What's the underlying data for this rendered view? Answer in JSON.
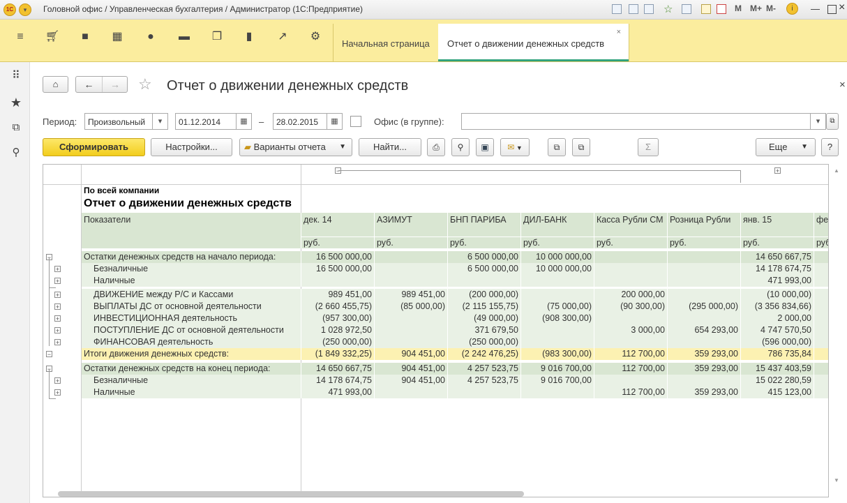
{
  "window": {
    "title": "Головной офис / Управленческая бухгалтерия / Администратор  (1С:Предприятие)",
    "toolbar_m": "M",
    "toolbar_mplus": "M+",
    "toolbar_mminus": "M-"
  },
  "tabs": [
    {
      "label": "Начальная страница"
    },
    {
      "label": "Отчет о движении денежных средств"
    }
  ],
  "page": {
    "title": "Отчет о движении денежных средств",
    "close": "×"
  },
  "filters": {
    "period_label": "Период:",
    "period_type": "Произвольный",
    "date_from": "01.12.2014",
    "date_sep": "–",
    "date_to": "28.02.2015",
    "office_label": "Офис (в группе):",
    "office_value": ""
  },
  "buttons": {
    "generate": "Сформировать",
    "settings": "Настройки...",
    "variants": "Варианты отчета",
    "find": "Найти...",
    "more": "Еще",
    "help": "?",
    "sigma": "Σ"
  },
  "report": {
    "company": "По всей компании",
    "title": "Отчет о движении денежных средств",
    "indicators_header": "Показатели",
    "columns": [
      {
        "name": "дек. 14",
        "unit": "руб."
      },
      {
        "name": "АЗИМУТ",
        "unit": "руб."
      },
      {
        "name": "БНП ПАРИБА",
        "unit": "руб."
      },
      {
        "name": "ДИЛ-БАНК",
        "unit": "руб."
      },
      {
        "name": "Касса Рубли СМ",
        "unit": "руб."
      },
      {
        "name": "Розница Рубли",
        "unit": "руб."
      },
      {
        "name": "янв. 15",
        "unit": "руб."
      },
      {
        "name": "фе",
        "unit": "руб"
      }
    ],
    "rows": [
      {
        "label": "Остатки денежных средств на начало периода:",
        "values": [
          "16 500 000,00",
          "",
          "6 500 000,00",
          "10 000 000,00",
          "",
          "",
          "14 650 667,75",
          ""
        ]
      },
      {
        "label": "Безналичные",
        "values": [
          "16 500 000,00",
          "",
          "6 500 000,00",
          "10 000 000,00",
          "",
          "",
          "14 178 674,75",
          ""
        ]
      },
      {
        "label": "Наличные",
        "values": [
          "",
          "",
          "",
          "",
          "",
          "",
          "471 993,00",
          ""
        ]
      },
      {
        "label": "ДВИЖЕНИЕ между Р/С и Кассами",
        "values": [
          "989 451,00",
          "989 451,00",
          "(200 000,00)",
          "",
          "200 000,00",
          "",
          "(10 000,00)",
          ""
        ]
      },
      {
        "label": "ВЫПЛАТЫ ДС от основной деятельности",
        "values": [
          "(2 660 455,75)",
          "(85 000,00)",
          "(2 115 155,75)",
          "(75 000,00)",
          "(90 300,00)",
          "(295 000,00)",
          "(3 356 834,66)",
          "("
        ]
      },
      {
        "label": "ИНВЕСТИЦИОННАЯ деятельность",
        "values": [
          "(957 300,00)",
          "",
          "(49 000,00)",
          "(908 300,00)",
          "",
          "",
          "2 000,00",
          ""
        ]
      },
      {
        "label": "ПОСТУПЛЕНИЕ ДС от основной деятельности",
        "values": [
          "1 028 972,50",
          "",
          "371 679,50",
          "",
          "3 000,00",
          "654 293,00",
          "4 747 570,50",
          ""
        ]
      },
      {
        "label": "ФИНАНСОВАЯ деятельность",
        "values": [
          "(250 000,00)",
          "",
          "(250 000,00)",
          "",
          "",
          "",
          "(596 000,00)",
          ""
        ]
      },
      {
        "label": "Итоги движения денежных средств:",
        "values": [
          "(1 849 332,25)",
          "904 451,00",
          "(2 242 476,25)",
          "(983 300,00)",
          "112 700,00",
          "359 293,00",
          "786 735,84",
          "("
        ]
      },
      {
        "label": "Остатки денежных средств на конец периода:",
        "values": [
          "14 650 667,75",
          "904 451,00",
          "4 257 523,75",
          "9 016 700,00",
          "112 700,00",
          "359 293,00",
          "15 437 403,59",
          ""
        ]
      },
      {
        "label": "Безналичные",
        "values": [
          "14 178 674,75",
          "904 451,00",
          "4 257 523,75",
          "9 016 700,00",
          "",
          "",
          "15 022 280,59",
          ""
        ]
      },
      {
        "label": "Наличные",
        "values": [
          "471 993,00",
          "",
          "",
          "",
          "112 700,00",
          "359 293,00",
          "415 123,00",
          ""
        ]
      }
    ]
  }
}
